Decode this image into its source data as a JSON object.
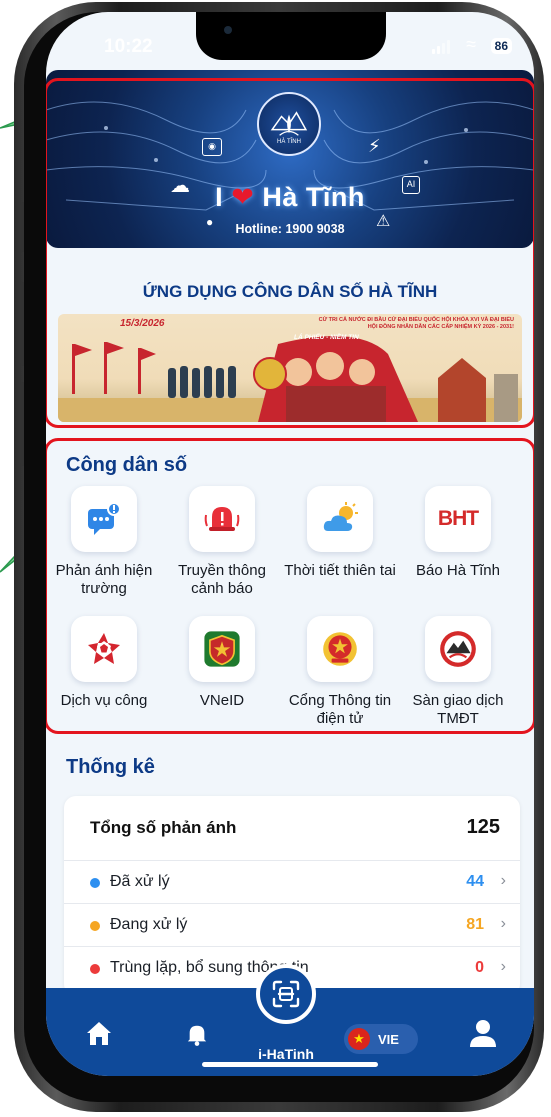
{
  "status_bar": {
    "time": "10:22",
    "battery": "86"
  },
  "banner": {
    "emblem_text": "HÀ TĨNH",
    "slogan_prefix": "I",
    "slogan_city": "Hà Tĩnh",
    "hotline": "Hotline: 1900 9038"
  },
  "app_title": "ỨNG DỤNG CÔNG DÂN SỐ HÀ TĨNH",
  "poster": {
    "date": "15/3/2026",
    "note": "CỬ TRI CẢ NƯỚC ĐI BẦU CỬ ĐẠI BIỂU QUỐC HỘI KHÓA XVI VÀ ĐẠI BIỂU HỘI ĐỒNG NHÂN DÂN CÁC CẤP NHIỆM KỲ 2026 - 2031!",
    "tag": "LÁ PHIẾU - NIỀM TIN"
  },
  "services": {
    "title": "Công dân số",
    "items": [
      {
        "label": "Phản ánh hiện trường",
        "icon": "chat-alert-icon"
      },
      {
        "label": "Truyền thông cảnh báo",
        "icon": "alarm-bell-icon"
      },
      {
        "label": "Thời tiết thiên tai",
        "icon": "weather-icon"
      },
      {
        "label": "Báo Hà Tĩnh",
        "icon": "bht-logo-icon",
        "logo_text": "BHT"
      },
      {
        "label": "Dịch vụ công",
        "icon": "public-service-icon"
      },
      {
        "label": "VNeID",
        "icon": "vneid-icon"
      },
      {
        "label": "Cổng Thông tin điện tử",
        "icon": "national-emblem-icon"
      },
      {
        "label": "Sàn giao dịch TMĐT",
        "icon": "ecommerce-logo-icon"
      }
    ]
  },
  "stats": {
    "title": "Thống kê",
    "total_label": "Tổng số phản ánh",
    "total": "125",
    "rows": [
      {
        "label": "Đã xử lý",
        "value": "44",
        "color": "#2d8ff0"
      },
      {
        "label": "Đang xử lý",
        "value": "81",
        "color": "#f5a623"
      },
      {
        "label": "Trùng lặp, bổ sung thông tin",
        "value": "0",
        "color": "#ec3b3b"
      }
    ]
  },
  "nav": {
    "scan_label": "i-HaTinh",
    "lang": "VIE",
    "colors": {
      "nav_bg": "#0f4a9a",
      "accent_red": "#e3141e",
      "title_blue": "#0d3a86"
    }
  }
}
